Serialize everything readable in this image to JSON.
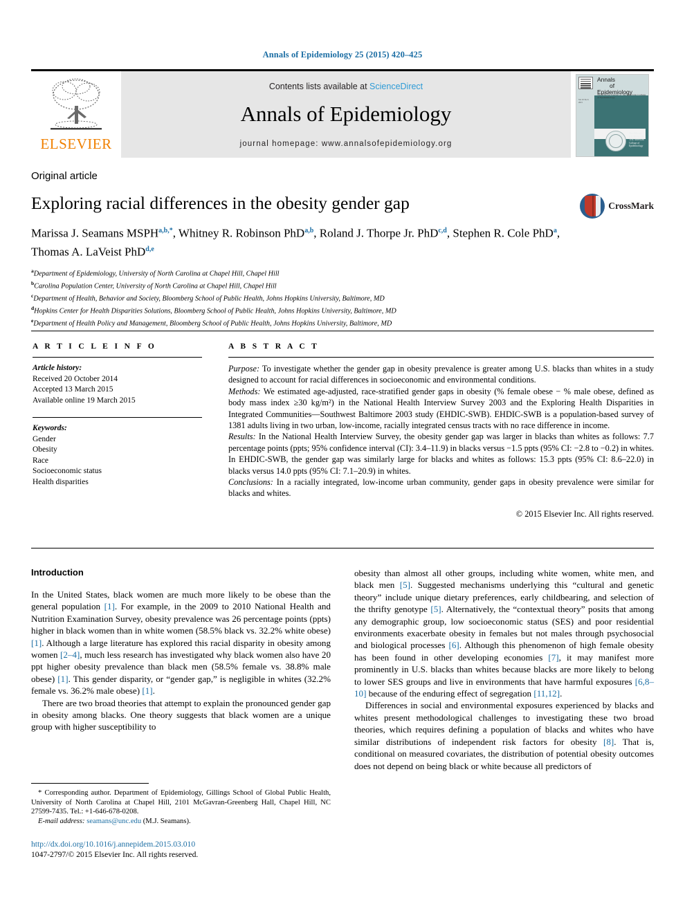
{
  "running_head": "Annals of Epidemiology 25 (2015) 420–425",
  "masthead": {
    "publisher_name": "ELSEVIER",
    "contents_prefix": "Contents lists available at ",
    "contents_link": "ScienceDirect",
    "journal_title": "Annals of Epidemiology",
    "homepage": "journal homepage: www.annalsofepidemiology.org",
    "cover": {
      "line1": "Annals",
      "line2": "of",
      "line3": "Epidemiology",
      "subtitle": "The Official Journal of the American College of Epidemiology",
      "seal_text": "The Official JOURNAL OF THE American College of Epidemiology"
    }
  },
  "article": {
    "type": "Original article",
    "title": "Exploring racial differences in the obesity gender gap",
    "crossmark_label": "CrossMark",
    "authors_html": "Marissa J. Seamans MSPH<sup>a,b,*</sup>, Whitney R. Robinson PhD<sup>a,b</sup>, Roland J. Thorpe Jr. PhD<sup>c,d</sup>, Stephen R. Cole PhD<sup>a</sup>, Thomas A. LaVeist PhD<sup>d,e</sup>",
    "affiliations": [
      {
        "mark": "a",
        "text": "Department of Epidemiology, University of North Carolina at Chapel Hill, Chapel Hill"
      },
      {
        "mark": "b",
        "text": "Carolina Population Center, University of North Carolina at Chapel Hill, Chapel Hill"
      },
      {
        "mark": "c",
        "text": "Department of Health, Behavior and Society, Bloomberg School of Public Health, Johns Hopkins University, Baltimore, MD"
      },
      {
        "mark": "d",
        "text": "Hopkins Center for Health Disparities Solutions, Bloomberg School of Public Health, Johns Hopkins University, Baltimore, MD"
      },
      {
        "mark": "e",
        "text": "Department of Health Policy and Management, Bloomberg School of Public Health, Johns Hopkins University, Baltimore, MD"
      }
    ]
  },
  "article_info": {
    "heading": "A R T I C L E   I N F O",
    "history_label": "Article history:",
    "history": [
      "Received 20 October 2014",
      "Accepted 13 March 2015",
      "Available online 19 March 2015"
    ],
    "keywords_label": "Keywords:",
    "keywords": [
      "Gender",
      "Obesity",
      "Race",
      "Socioeconomic status",
      "Health disparities"
    ]
  },
  "abstract": {
    "heading": "A B S T R A C T",
    "sections": [
      {
        "label": "Purpose:",
        "text": " To investigate whether the gender gap in obesity prevalence is greater among U.S. blacks than whites in a study designed to account for racial differences in socioeconomic and environmental conditions."
      },
      {
        "label": "Methods:",
        "text": " We estimated age-adjusted, race-stratified gender gaps in obesity (% female obese − % male obese, defined as body mass index ≥30 kg/m²) in the National Health Interview Survey 2003 and the Exploring Health Disparities in Integrated Communities—Southwest Baltimore 2003 study (EHDIC-SWB). EHDIC-SWB is a population-based survey of 1381 adults living in two urban, low-income, racially integrated census tracts with no race difference in income."
      },
      {
        "label": "Results:",
        "text": " In the National Health Interview Survey, the obesity gender gap was larger in blacks than whites as follows: 7.7 percentage points (ppts; 95% confidence interval (CI): 3.4–11.9) in blacks versus −1.5 ppts (95% CI: −2.8 to −0.2) in whites. In EHDIC-SWB, the gender gap was similarly large for blacks and whites as follows: 15.3 ppts (95% CI: 8.6–22.0) in blacks versus 14.0 ppts (95% CI: 7.1–20.9) in whites."
      },
      {
        "label": "Conclusions:",
        "text": " In a racially integrated, low-income urban community, gender gaps in obesity prevalence were similar for blacks and whites."
      }
    ],
    "copyright": "© 2015 Elsevier Inc. All rights reserved."
  },
  "body": {
    "intro_heading": "Introduction",
    "left_paragraphs": [
      "In the United States, black women are much more likely to be obese than the general population [1]. For example, in the 2009 to 2010 National Health and Nutrition Examination Survey, obesity prevalence was 26 percentage points (ppts) higher in black women than in white women (58.5% black vs. 32.2% white obese) [1]. Although a large literature has explored this racial disparity in obesity among women [2–4], much less research has investigated why black women also have 20 ppt higher obesity prevalence than black men (58.5% female vs. 38.8% male obese) [1]. This gender disparity, or “gender gap,” is negligible in whites (32.2% female vs. 36.2% male obese) [1].",
      "There are two broad theories that attempt to explain the pronounced gender gap in obesity among blacks. One theory suggests that black women are a unique group with higher susceptibility to"
    ],
    "right_paragraphs": [
      "obesity than almost all other groups, including white women, white men, and black men [5]. Suggested mechanisms underlying this “cultural and genetic theory” include unique dietary preferences, early childbearing, and selection of the thrifty genotype [5]. Alternatively, the “contextual theory” posits that among any demographic group, low socioeconomic status (SES) and poor residential environments exacerbate obesity in females but not males through psychosocial and biological processes [6]. Although this phenomenon of high female obesity has been found in other developing economies [7], it may manifest more prominently in U.S. blacks than whites because blacks are more likely to belong to lower SES groups and live in environments that have harmful exposures [6,8–10] because of the enduring effect of segregation [11,12].",
      "Differences in social and environmental exposures experienced by blacks and whites present methodological challenges to investigating these two broad theories, which requires defining a population of blacks and whites who have similar distributions of independent risk factors for obesity [8]. That is, conditional on measured covariates, the distribution of potential obesity outcomes does not depend on being black or white because all predictors of"
    ]
  },
  "footnote": {
    "corresponding": "* Corresponding author. Department of Epidemiology, Gillings School of Global Public Health, University of North Carolina at Chapel Hill, 2101 McGavran-Greenberg Hall, Chapel Hill, NC 27599-7435. Tel.: +1-646-678-0208.",
    "email_label": "E-mail address:",
    "email": "seamans@unc.edu",
    "email_suffix": " (M.J. Seamans).",
    "doi": "http://dx.doi.org/10.1016/j.annepidem.2015.03.010",
    "issn_line": "1047-2797/© 2015 Elsevier Inc. All rights reserved."
  },
  "colors": {
    "link": "#1c6ea4",
    "sciencedirect": "#2e9bd6",
    "elsevier_orange": "#f08000",
    "cover_teal": "#3c7374"
  }
}
